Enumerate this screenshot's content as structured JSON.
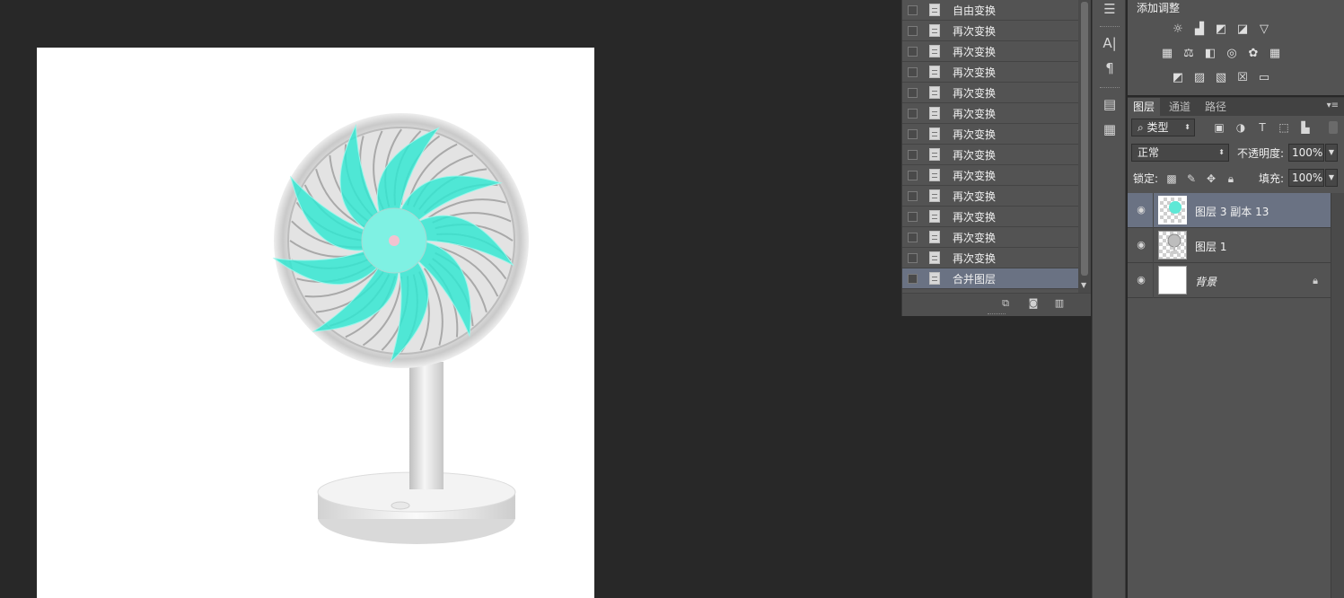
{
  "history": {
    "items": [
      {
        "label": "自由变换",
        "selected": false
      },
      {
        "label": "再次变换",
        "selected": false
      },
      {
        "label": "再次变换",
        "selected": false
      },
      {
        "label": "再次变换",
        "selected": false
      },
      {
        "label": "再次变换",
        "selected": false
      },
      {
        "label": "再次变换",
        "selected": false
      },
      {
        "label": "再次变换",
        "selected": false
      },
      {
        "label": "再次变换",
        "selected": false
      },
      {
        "label": "再次变换",
        "selected": false
      },
      {
        "label": "再次变换",
        "selected": false
      },
      {
        "label": "再次变换",
        "selected": false
      },
      {
        "label": "再次变换",
        "selected": false
      },
      {
        "label": "再次变换",
        "selected": false
      },
      {
        "label": "合并图层",
        "selected": true
      }
    ]
  },
  "adjustments": {
    "title": "添加调整"
  },
  "layers_panel": {
    "tabs": [
      {
        "label": "图层",
        "active": true
      },
      {
        "label": "通道",
        "active": false
      },
      {
        "label": "路径",
        "active": false
      }
    ],
    "filter": {
      "value": "类型"
    },
    "blend_mode": {
      "value": "正常"
    },
    "opacity": {
      "label": "不透明度:",
      "value": "100%"
    },
    "lock": {
      "label": "锁定:"
    },
    "fill": {
      "label": "填充:",
      "value": "100%"
    },
    "layers": [
      {
        "name": "图层 3 副本 13",
        "selected": true,
        "thumb": "fan-blades",
        "locked": false
      },
      {
        "name": "图层 1",
        "selected": false,
        "thumb": "fan-body",
        "locked": false
      },
      {
        "name": "背景",
        "selected": false,
        "thumb": "white",
        "locked": true
      }
    ]
  },
  "colors": {
    "blade": "#2ee8d2",
    "selection": "#6a7283",
    "panel": "#535353",
    "workspace": "#282828"
  }
}
